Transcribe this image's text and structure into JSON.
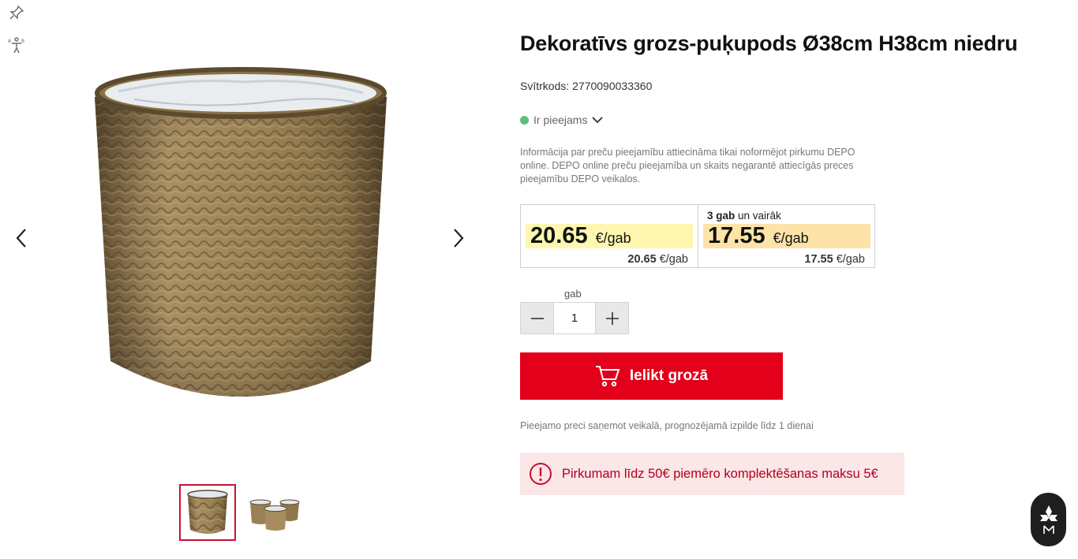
{
  "side_tools": {
    "pin_icon": "pin-icon",
    "accessibility_icon": "text-accessibility-icon"
  },
  "gallery": {
    "main_image_alt": "basket-planter-image",
    "prev_icon": "chevron-left-icon",
    "next_icon": "chevron-right-icon",
    "thumbnails": [
      "basket-single-thumbnail",
      "basket-set-thumbnail"
    ]
  },
  "product": {
    "title": "Dekoratīvs grozs-puķupods Ø38cm H38cm niedru",
    "barcode": "Svītrkods: 2770090033360",
    "availability": "Ir pieejams",
    "availability_color": "#5ec07c",
    "notice": "Informācija par preču pieejamību attiecināma tikai noformējot pirkumu DEPO online. DEPO online preču pieejamība  un skaits negarantē attiecīgās preces pieejamību DEPO veikalos."
  },
  "pricing": {
    "single": {
      "price": "20.65",
      "unit": "€/gab",
      "sub_price": "20.65",
      "sub_unit": "€/gab"
    },
    "bulk": {
      "qty_label": "3 gab",
      "qty_suffix": "un vairāk",
      "price": "17.55",
      "unit": "€/gab",
      "sub_price": "17.55",
      "sub_unit": "€/gab"
    }
  },
  "quantity": {
    "label": "gab",
    "value": "1"
  },
  "cart": {
    "button_label": "Ielikt grozā",
    "accent": "#e2001a"
  },
  "fulfilment": "Pieejamo preci saņemot veikalā, prognozējamā izpilde līdz 1 dienai",
  "fee_notice": {
    "text": "Pirkumam līdz 50€ piemēro komplektēšanas maksu 5€",
    "color": "#b3001b"
  }
}
